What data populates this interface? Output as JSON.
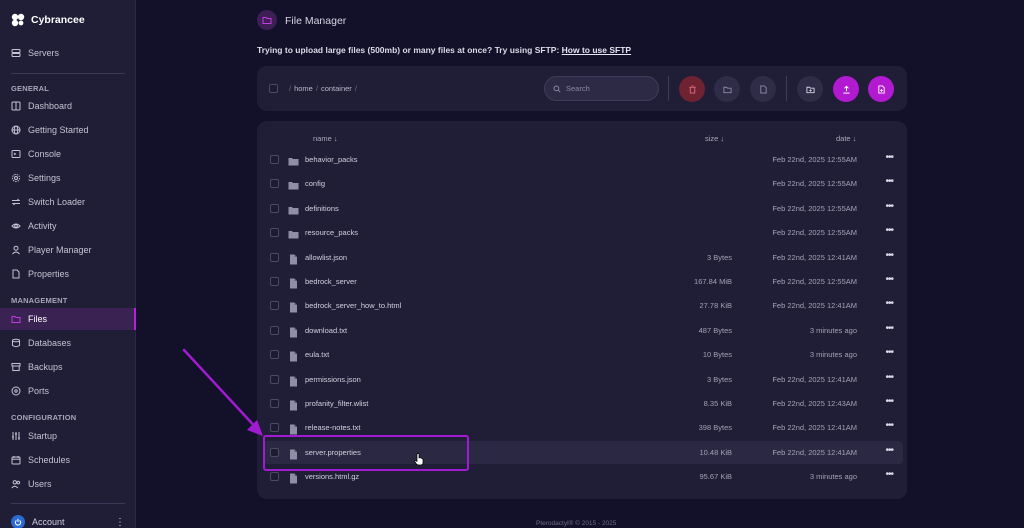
{
  "brand": {
    "name": "Cybrancee"
  },
  "sidebar": {
    "servers_label": "Servers",
    "sections": {
      "general": "GENERAL",
      "management": "MANAGEMENT",
      "configuration": "CONFIGURATION"
    },
    "items": {
      "dashboard": "Dashboard",
      "getting_started": "Getting Started",
      "console": "Console",
      "settings": "Settings",
      "switch_loader": "Switch Loader",
      "activity": "Activity",
      "player_manager": "Player Manager",
      "properties": "Properties",
      "files": "Files",
      "databases": "Databases",
      "backups": "Backups",
      "ports": "Ports",
      "startup": "Startup",
      "schedules": "Schedules",
      "users": "Users"
    },
    "account_label": "Account",
    "active_color": "#b421d8"
  },
  "header": {
    "title": "File Manager",
    "sftp_text": "Trying to upload large files (500mb) or many files at once? Try using SFTP: ",
    "sftp_link": "How to use SFTP"
  },
  "toolbar": {
    "breadcrumb": [
      "home",
      "container"
    ],
    "search_placeholder": "Search",
    "icons": [
      "trash-icon",
      "archive-folder-icon",
      "file-icon",
      "new-folder-icon",
      "upload-icon",
      "new-file-icon"
    ]
  },
  "table": {
    "headers": {
      "name": "name ↓",
      "size": "size ↓",
      "date": "date ↓"
    },
    "rows": [
      {
        "type": "folder",
        "name": "behavior_packs",
        "size": "",
        "date": "Feb 22nd, 2025 12:55AM"
      },
      {
        "type": "folder",
        "name": "config",
        "size": "",
        "date": "Feb 22nd, 2025 12:55AM"
      },
      {
        "type": "folder",
        "name": "definitions",
        "size": "",
        "date": "Feb 22nd, 2025 12:55AM"
      },
      {
        "type": "folder",
        "name": "resource_packs",
        "size": "",
        "date": "Feb 22nd, 2025 12:55AM"
      },
      {
        "type": "file",
        "name": "allowlist.json",
        "size": "3 Bytes",
        "date": "Feb 22nd, 2025 12:41AM"
      },
      {
        "type": "file",
        "name": "bedrock_server",
        "size": "167.84 MiB",
        "date": "Feb 22nd, 2025 12:55AM"
      },
      {
        "type": "file",
        "name": "bedrock_server_how_to.html",
        "size": "27.78 KiB",
        "date": "Feb 22nd, 2025 12:41AM"
      },
      {
        "type": "file",
        "name": "download.txt",
        "size": "487 Bytes",
        "date": "3 minutes ago"
      },
      {
        "type": "file",
        "name": "eula.txt",
        "size": "10 Bytes",
        "date": "3 minutes ago"
      },
      {
        "type": "file",
        "name": "permissions.json",
        "size": "3 Bytes",
        "date": "Feb 22nd, 2025 12:41AM"
      },
      {
        "type": "file",
        "name": "profanity_filter.wlist",
        "size": "8.35 KiB",
        "date": "Feb 22nd, 2025 12:43AM"
      },
      {
        "type": "file",
        "name": "release-notes.txt",
        "size": "398 Bytes",
        "date": "Feb 22nd, 2025 12:41AM"
      },
      {
        "type": "file",
        "name": "server.properties",
        "size": "10.48 KiB",
        "date": "Feb 22nd, 2025 12:41AM",
        "highlighted": true
      },
      {
        "type": "file",
        "name": "versions.html.gz",
        "size": "95.67 KiB",
        "date": "3 minutes ago"
      }
    ],
    "row_menu_glyph": "•••"
  },
  "footer": {
    "text": "Pterodactyl® © 2015 - 2025"
  },
  "colors": {
    "background": "#131129",
    "panel": "#201e36",
    "accent": "#b11ad0",
    "danger": "#6e2232",
    "annotation": "#a11bd1"
  }
}
